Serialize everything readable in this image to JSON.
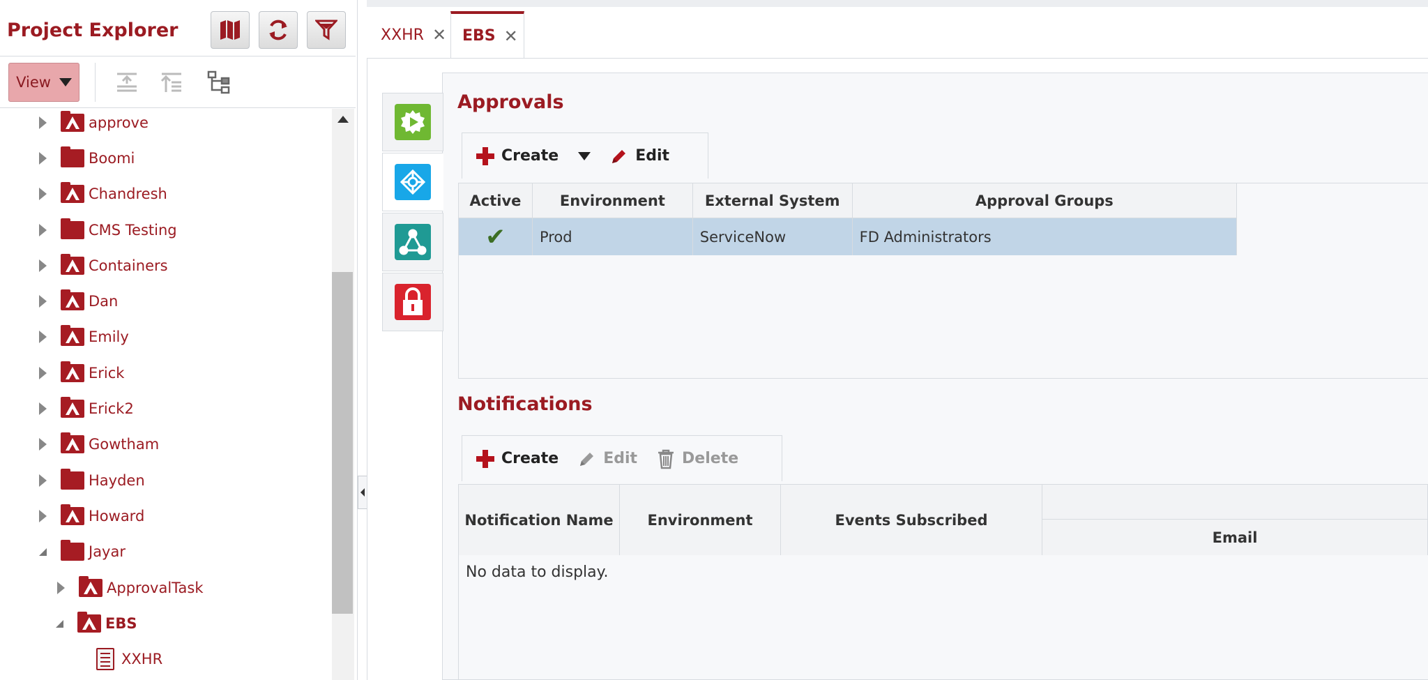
{
  "project_explorer": {
    "title": "Project Explorer",
    "header_buttons": [
      "map-icon",
      "refresh-icon",
      "filter-icon"
    ],
    "view_label": "View",
    "toolbar_icons": [
      "collapse-all-icon",
      "expand-all-icon",
      "tree-structure-icon"
    ],
    "tree": [
      {
        "label": "approve",
        "icon": "project-folder",
        "expanded": false
      },
      {
        "label": "Boomi",
        "icon": "plain-folder",
        "expanded": false
      },
      {
        "label": "Chandresh",
        "icon": "project-folder",
        "expanded": false
      },
      {
        "label": "CMS Testing",
        "icon": "plain-folder",
        "expanded": false
      },
      {
        "label": "Containers",
        "icon": "project-folder",
        "expanded": false
      },
      {
        "label": "Dan",
        "icon": "project-folder",
        "expanded": false
      },
      {
        "label": "Emily",
        "icon": "project-folder",
        "expanded": false
      },
      {
        "label": "Erick",
        "icon": "project-folder",
        "expanded": false
      },
      {
        "label": "Erick2",
        "icon": "project-folder",
        "expanded": false
      },
      {
        "label": "Gowtham",
        "icon": "project-folder",
        "expanded": false
      },
      {
        "label": "Hayden",
        "icon": "plain-folder",
        "expanded": false
      },
      {
        "label": "Howard",
        "icon": "project-folder",
        "expanded": false
      },
      {
        "label": "Jayar",
        "icon": "plain-folder",
        "expanded": true
      },
      {
        "label": "ApprovalTask",
        "icon": "project-folder",
        "expanded": false,
        "level": 1
      },
      {
        "label": "EBS",
        "icon": "project-folder",
        "expanded": true,
        "level": 1,
        "selected": true
      },
      {
        "label": "XXHR",
        "icon": "document",
        "level": 2
      }
    ]
  },
  "tabs": [
    {
      "label": "XXHR",
      "active": false
    },
    {
      "label": "EBS",
      "active": true
    }
  ],
  "side_tabs": [
    "deploy-icon",
    "integration-icon",
    "network-icon",
    "lock-icon"
  ],
  "approvals": {
    "title": "Approvals",
    "actions": {
      "create": "Create",
      "edit": "Edit"
    },
    "columns": [
      "Active",
      "Environment",
      "External System",
      "Approval Groups"
    ],
    "rows": [
      {
        "active": "✔",
        "environment": "Prod",
        "external_system": "ServiceNow",
        "approval_groups": "FD Administrators"
      }
    ]
  },
  "notifications": {
    "title": "Notifications",
    "actions": {
      "create": "Create",
      "edit": "Edit",
      "delete": "Delete"
    },
    "columns": [
      "Notification Name",
      "Environment",
      "Events Subscribed",
      "Email"
    ],
    "empty_text": "No data to display."
  },
  "colors": {
    "brand_red": "#9b1b22",
    "selected_row": "#c1d5e7",
    "view_button": "#e8a7ab"
  }
}
